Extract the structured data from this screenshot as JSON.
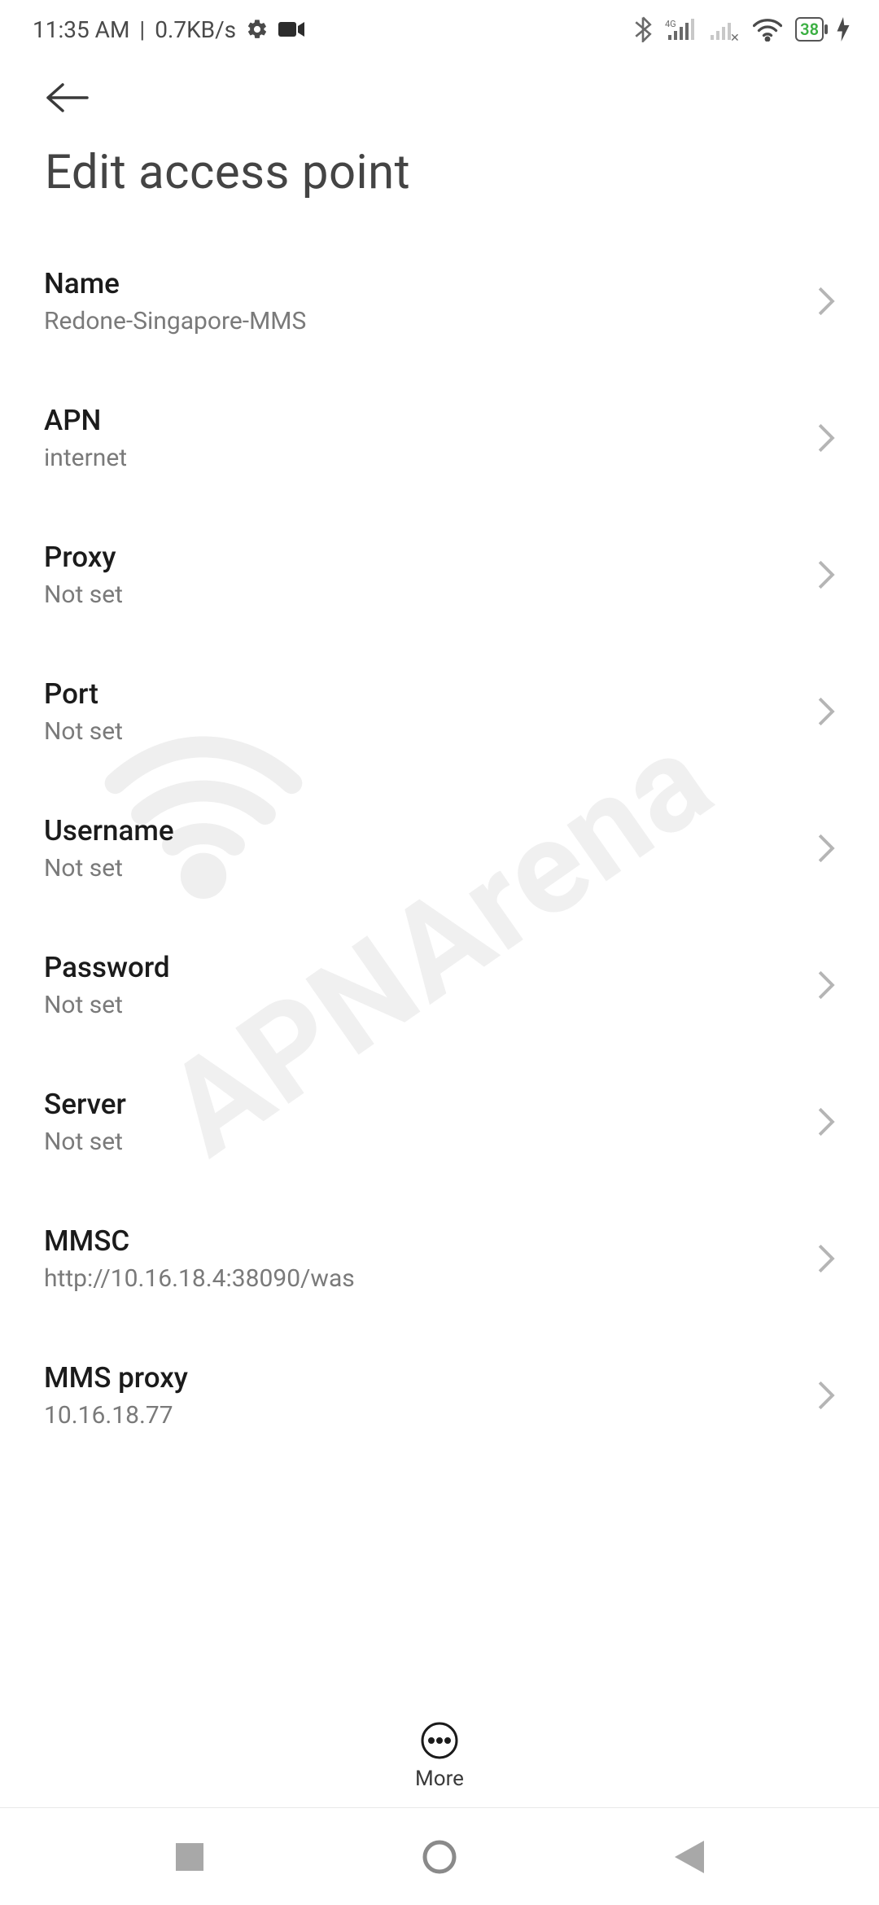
{
  "status_bar": {
    "time": "11:35 AM",
    "speed": "0.7KB/s",
    "battery_percent": "38"
  },
  "header": {
    "title": "Edit access point"
  },
  "settings": [
    {
      "label": "Name",
      "value": "Redone-Singapore-MMS"
    },
    {
      "label": "APN",
      "value": "internet"
    },
    {
      "label": "Proxy",
      "value": "Not set"
    },
    {
      "label": "Port",
      "value": "Not set"
    },
    {
      "label": "Username",
      "value": "Not set"
    },
    {
      "label": "Password",
      "value": "Not set"
    },
    {
      "label": "Server",
      "value": "Not set"
    },
    {
      "label": "MMSC",
      "value": "http://10.16.18.4:38090/was"
    },
    {
      "label": "MMS proxy",
      "value": "10.16.18.77"
    }
  ],
  "bottom_action": {
    "label": "More"
  },
  "watermark": "APNArena"
}
